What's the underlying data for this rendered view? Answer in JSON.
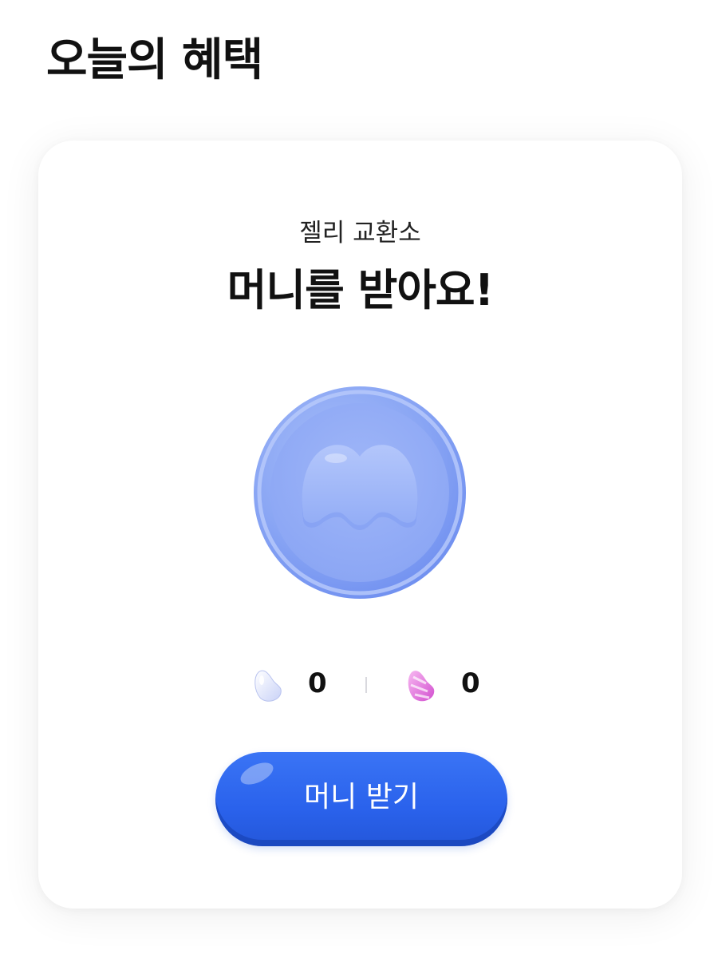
{
  "page": {
    "title": "오늘의 혜택"
  },
  "card": {
    "subtitle": "젤리 교환소",
    "headline": "머니를 받아요!",
    "coin_icon": "money-coin-icon",
    "counts": [
      {
        "icon": "white-jelly-icon",
        "value": "0"
      },
      {
        "icon": "pink-jelly-icon",
        "value": "0"
      }
    ],
    "button_label": "머니 받기"
  },
  "colors": {
    "accent_blue": "#2a62ec",
    "coin_blue": "#8ea9f5"
  }
}
